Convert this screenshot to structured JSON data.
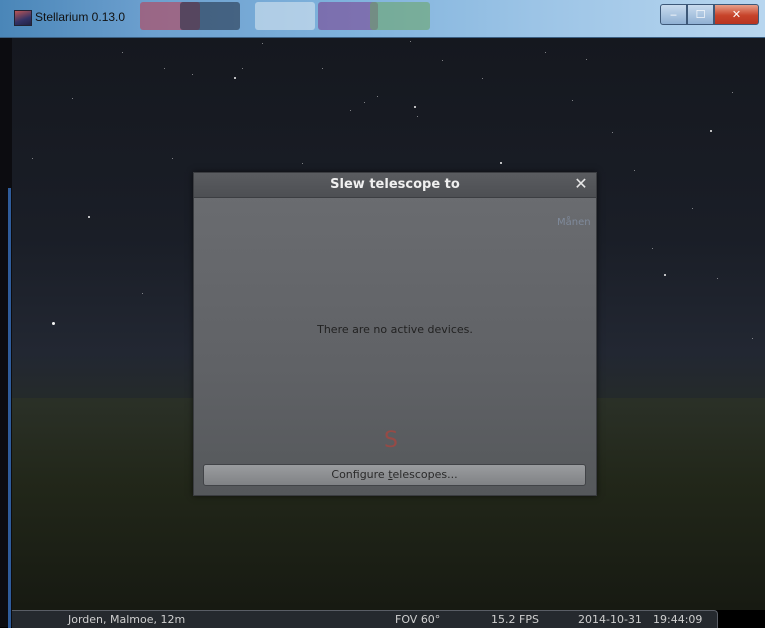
{
  "window": {
    "title": "Stellarium 0.13.0",
    "buttons": {
      "minimize": "‒",
      "maximize": "☐",
      "close": "✕"
    }
  },
  "dialog": {
    "title": "Slew telescope to",
    "close_glyph": "✕",
    "message": "There are no active devices.",
    "configure_button": {
      "prefix": "Configure ",
      "mnemonic": "t",
      "suffix": "elescopes..."
    }
  },
  "sky": {
    "faint_label": "Månen",
    "cardinal": "S"
  },
  "statusbar": {
    "location": "Jorden, Malmoe, 12m",
    "fov": "FOV 60°",
    "fps": "15.2 FPS",
    "date": "2014-10-31",
    "time": "19:44:09"
  },
  "colors": {
    "dialog_bg": "#606266",
    "titlebar_accent": "#6da0cf",
    "close_red": "#c7432a"
  }
}
